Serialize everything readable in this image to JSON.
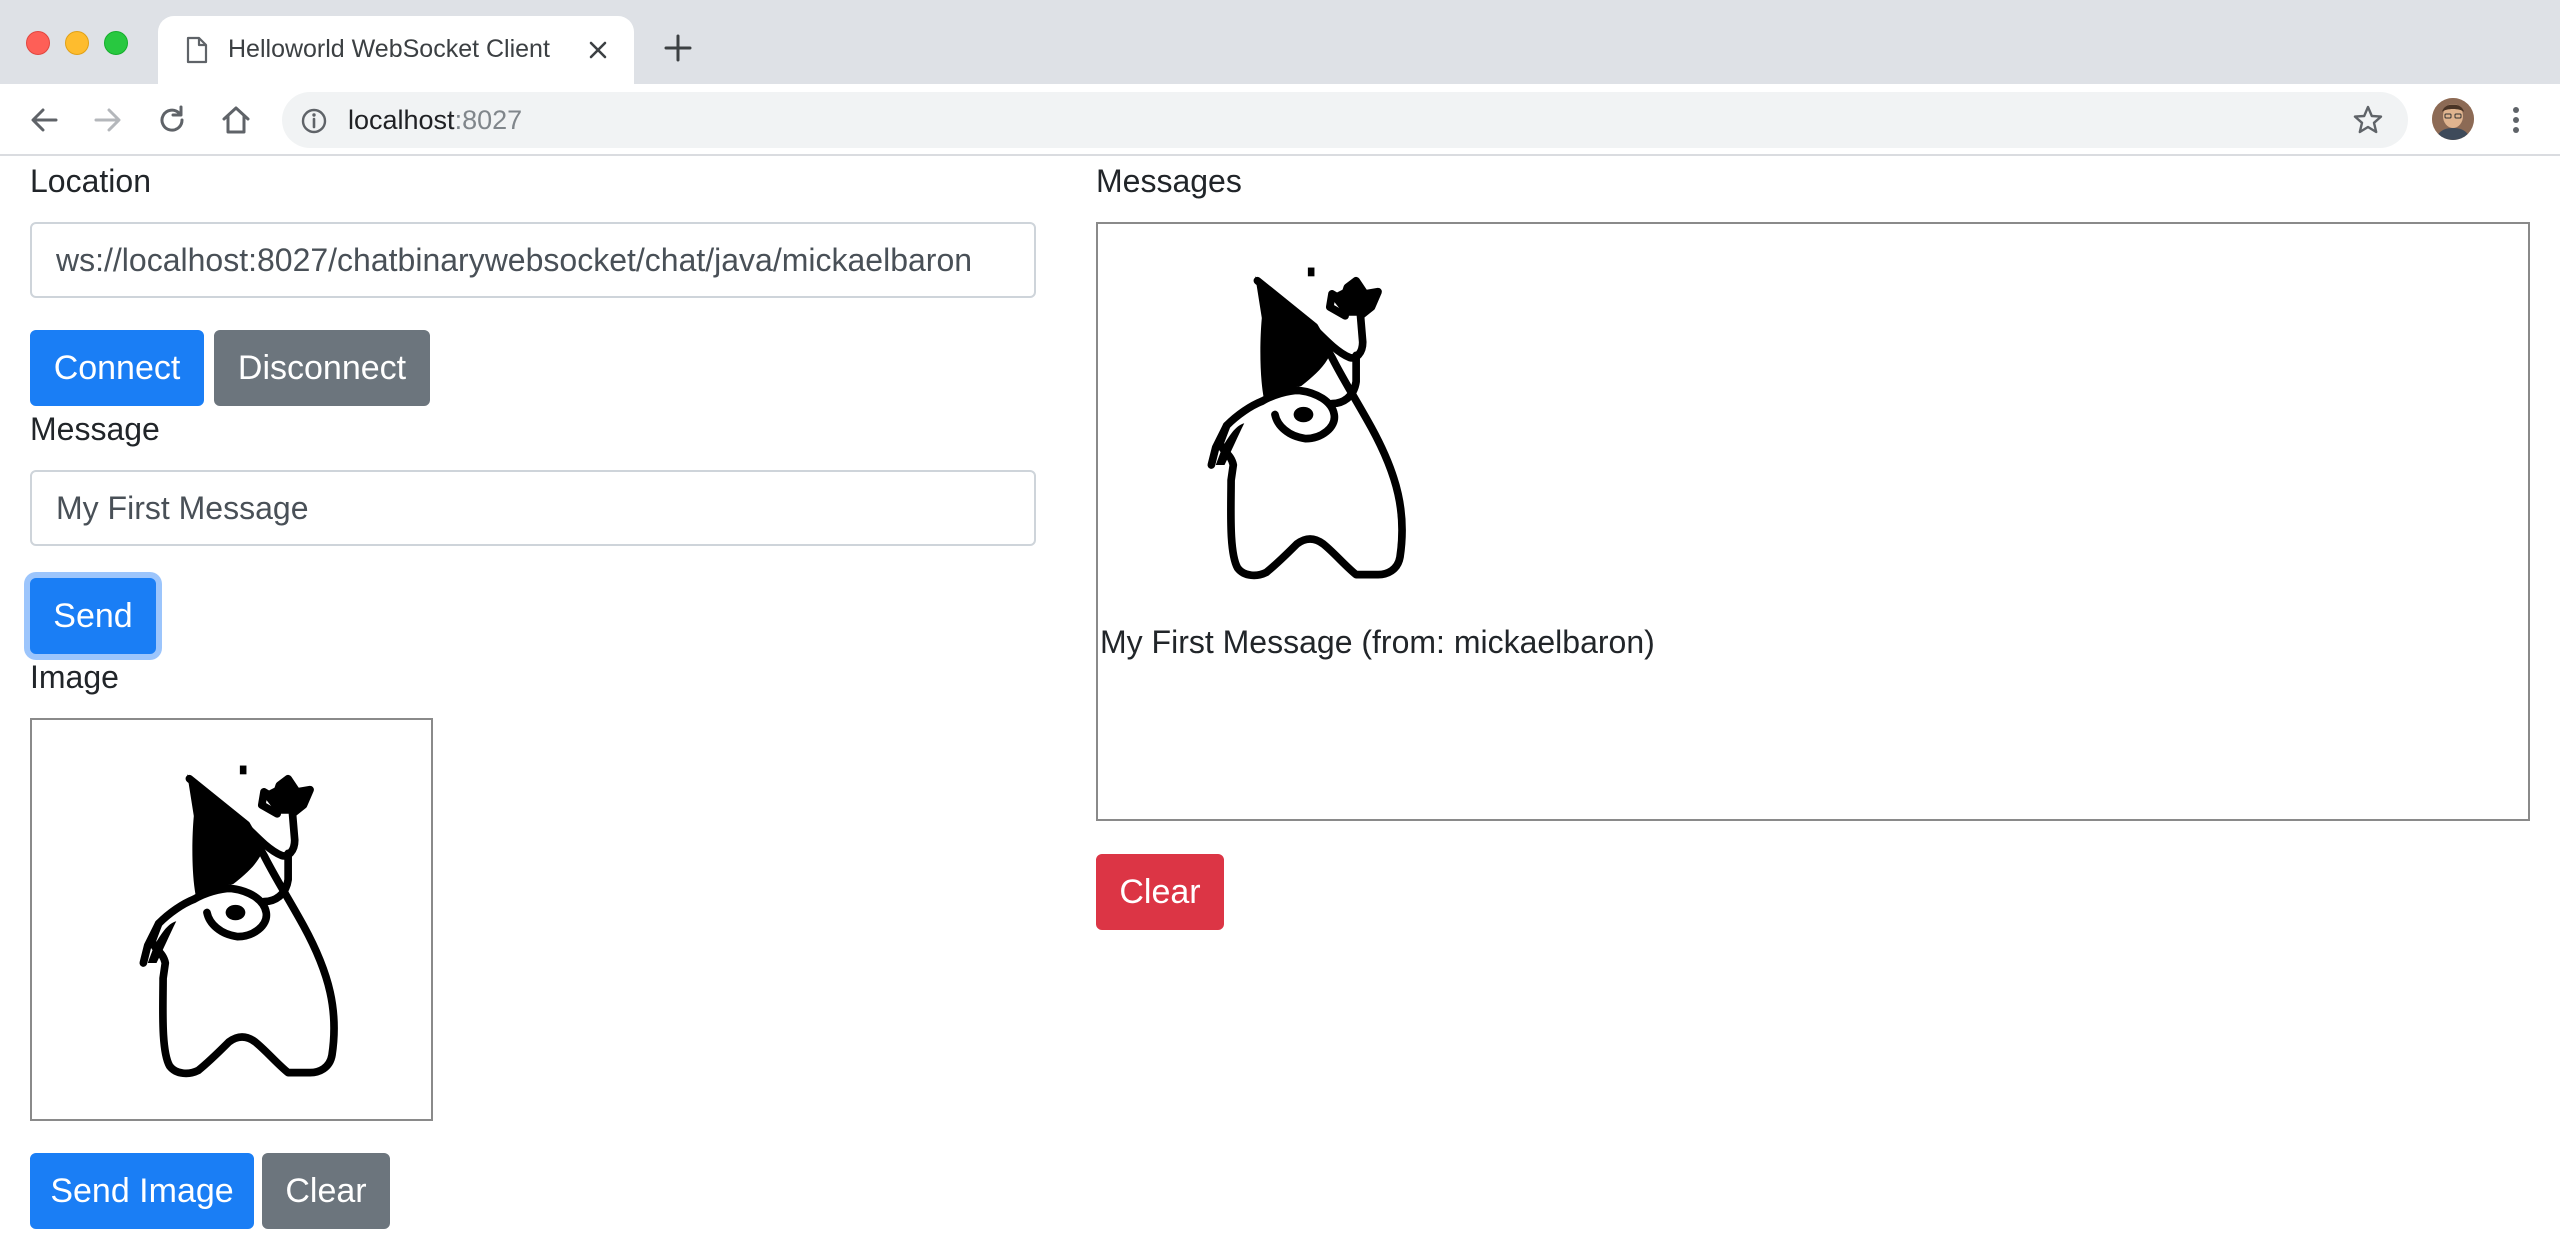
{
  "browser": {
    "tab_title": "Helloworld WebSocket Client",
    "url_host": "localhost",
    "url_port": ":8027"
  },
  "location": {
    "label": "Location",
    "value": "ws://localhost:8027/chatbinarywebsocket/chat/java/mickaelbaron",
    "connect_label": "Connect",
    "disconnect_label": "Disconnect"
  },
  "message": {
    "label": "Message",
    "value": "My First Message",
    "send_label": "Send"
  },
  "image": {
    "label": "Image",
    "send_label": "Send Image",
    "clear_label": "Clear"
  },
  "messages": {
    "label": "Messages",
    "items": [
      {
        "text": "My First Message (from: mickaelbaron)"
      }
    ],
    "clear_label": "Clear"
  },
  "colors": {
    "primary": "#1a7ef5",
    "secondary": "#6c757d",
    "danger": "#dc3545"
  },
  "icons": [
    "page-icon",
    "close-icon",
    "plus-icon",
    "back-arrow-icon",
    "forward-arrow-icon",
    "reload-icon",
    "home-icon",
    "info-icon",
    "star-icon",
    "kebab-menu-icon"
  ]
}
